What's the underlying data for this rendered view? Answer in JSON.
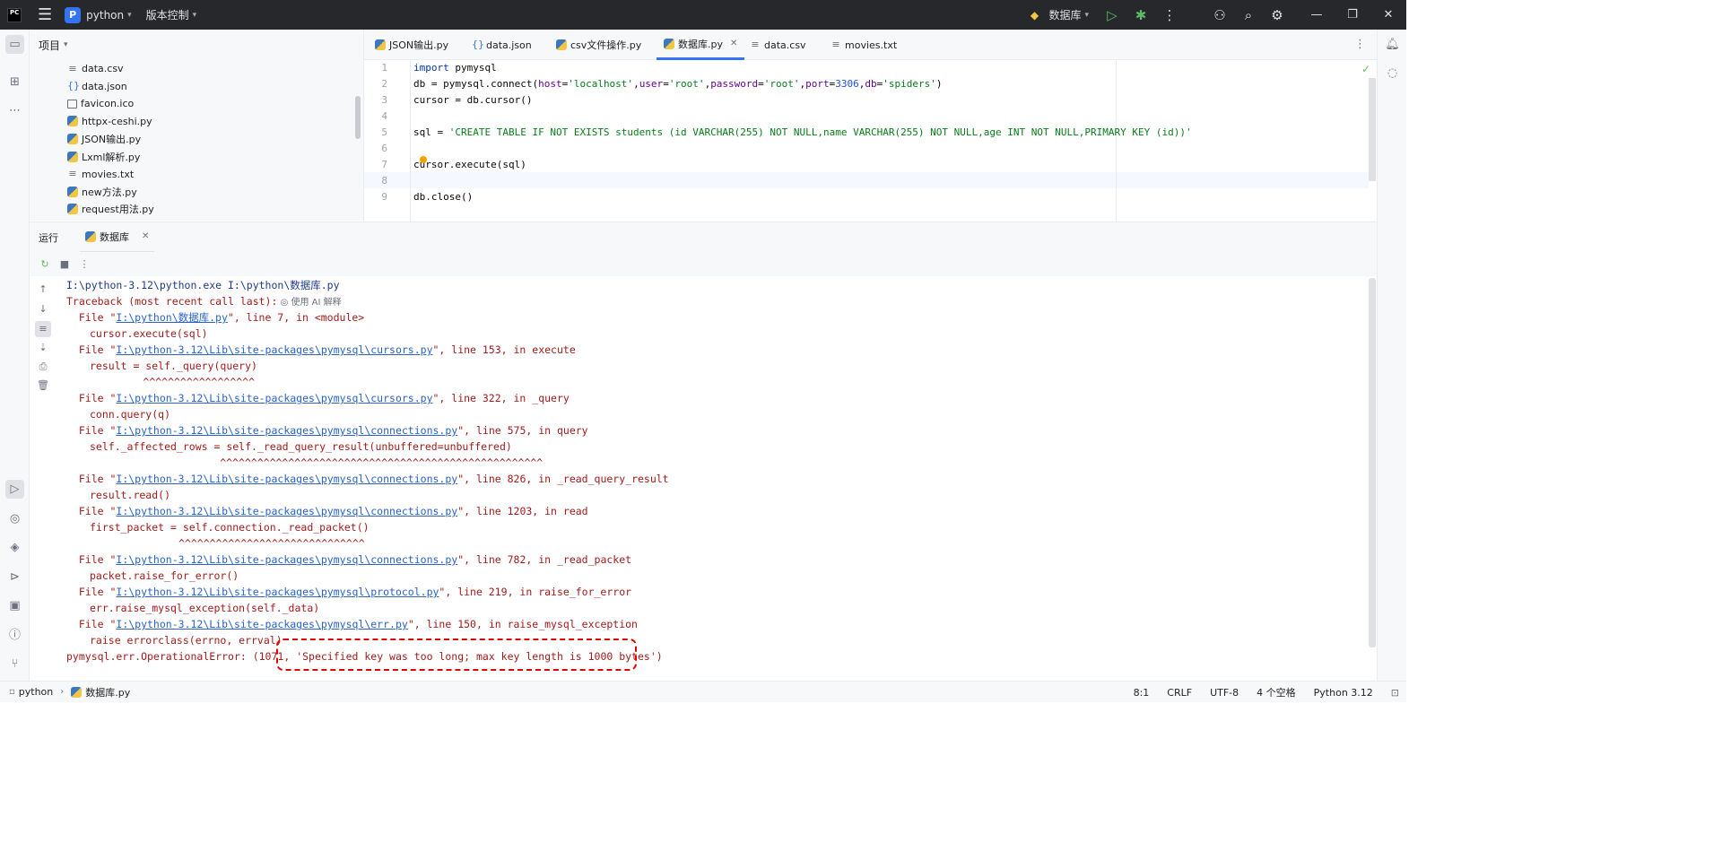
{
  "titlebar": {
    "logo": "PC",
    "project_name": "python",
    "vcs_label": "版本控制",
    "run_config": "数据库"
  },
  "project_panel": {
    "title": "项目",
    "files": [
      {
        "name": "data.csv",
        "type": "txt"
      },
      {
        "name": "data.json",
        "type": "json"
      },
      {
        "name": "favicon.ico",
        "type": "img"
      },
      {
        "name": "httpx-ceshi.py",
        "type": "py"
      },
      {
        "name": "JSON输出.py",
        "type": "py"
      },
      {
        "name": "Lxml解析.py",
        "type": "py"
      },
      {
        "name": "movies.txt",
        "type": "txt"
      },
      {
        "name": "new方法.py",
        "type": "py"
      },
      {
        "name": "request用法.py",
        "type": "py"
      }
    ]
  },
  "tabs": [
    {
      "label": "JSON输出.py",
      "icon": "python-file-icon",
      "active": false
    },
    {
      "label": "data.json",
      "icon": "json-file-icon",
      "active": false
    },
    {
      "label": "csv文件操作.py",
      "icon": "python-file-icon",
      "active": false
    },
    {
      "label": "数据库.py",
      "icon": "python-file-icon",
      "active": true
    },
    {
      "label": "data.csv",
      "icon": "text-file-icon",
      "active": false
    },
    {
      "label": "movies.txt",
      "icon": "text-file-icon",
      "active": false
    }
  ],
  "editor": {
    "line_numbers": [
      "1",
      "2",
      "3",
      "4",
      "5",
      "6",
      "7",
      "8",
      "9"
    ],
    "lines": [
      {
        "n": 1,
        "text": "import pymysql"
      },
      {
        "n": 2,
        "text": "db = pymysql.connect(host='localhost',user='root',password='root',port=3306,db='spiders')"
      },
      {
        "n": 3,
        "text": "cursor = db.cursor()"
      },
      {
        "n": 4,
        "text": ""
      },
      {
        "n": 5,
        "text": "sql = 'CREATE TABLE IF NOT EXISTS students (id VARCHAR(255) NOT NULL,name VARCHAR(255) NOT NULL,age INT NOT NULL,PRIMARY KEY (id))'"
      },
      {
        "n": 6,
        "text": ""
      },
      {
        "n": 7,
        "text": "cursor.execute(sql)"
      },
      {
        "n": 8,
        "text": ""
      },
      {
        "n": 9,
        "text": "db.close()"
      }
    ]
  },
  "run_panel": {
    "title": "运行",
    "tab_label": "数据库",
    "console": {
      "command": "I:\\python-3.12\\python.exe I:\\python\\数据库.py",
      "traceback_header": "Traceback (most recent call last):",
      "ai_hint": "使用 AI 解释",
      "frames": [
        {
          "path": "I:\\python\\数据库.py",
          "rest": "\", line 7, in <module>",
          "code": "cursor.execute(sql)",
          "marker": ""
        },
        {
          "path": "I:\\python-3.12\\Lib\\site-packages\\pymysql\\cursors.py",
          "rest": "\", line 153, in execute",
          "code": "result = self._query(query)",
          "marker": "^^^^^^^^^^^^^^^^^^"
        },
        {
          "path": "I:\\python-3.12\\Lib\\site-packages\\pymysql\\cursors.py",
          "rest": "\", line 322, in _query",
          "code": "conn.query(q)",
          "marker": ""
        },
        {
          "path": "I:\\python-3.12\\Lib\\site-packages\\pymysql\\connections.py",
          "rest": "\", line 575, in query",
          "code": "self._affected_rows = self._read_query_result(unbuffered=unbuffered)",
          "marker": "^^^^^^^^^^^^^^^^^^^^^^^^^^^^^^^^^^^^^^^^^^^^^^^^^^^^"
        },
        {
          "path": "I:\\python-3.12\\Lib\\site-packages\\pymysql\\connections.py",
          "rest": "\", line 826, in _read_query_result",
          "code": "result.read()",
          "marker": ""
        },
        {
          "path": "I:\\python-3.12\\Lib\\site-packages\\pymysql\\connections.py",
          "rest": "\", line 1203, in read",
          "code": "first_packet = self.connection._read_packet()",
          "marker": "^^^^^^^^^^^^^^^^^^^^^^^^^^^^^^"
        },
        {
          "path": "I:\\python-3.12\\Lib\\site-packages\\pymysql\\connections.py",
          "rest": "\", line 782, in _read_packet",
          "code": "packet.raise_for_error()",
          "marker": ""
        },
        {
          "path": "I:\\python-3.12\\Lib\\site-packages\\pymysql\\protocol.py",
          "rest": "\", line 219, in raise_for_error",
          "code": "err.raise_mysql_exception(self._data)",
          "marker": ""
        },
        {
          "path": "I:\\python-3.12\\Lib\\site-packages\\pymysql\\err.py",
          "rest": "\", line 150, in raise_mysql_exception",
          "code": "raise errorclass(errno, errval)",
          "marker": ""
        }
      ],
      "error_prefix": "pymysql.err.OperationalError: (1071, ",
      "error_message": "'Specified key was too long; max key length is 1000 bytes')"
    }
  },
  "statusbar": {
    "crumb_project": "python",
    "crumb_file": "数据库.py",
    "position": "8:1",
    "line_sep": "CRLF",
    "encoding": "UTF-8",
    "indent": "4 个空格",
    "interpreter": "Python 3.12"
  },
  "colors": {
    "accent": "#3574f0",
    "error_text": "#a21b1b",
    "link": "#2a62c9",
    "highlight_box": "#e00000"
  }
}
